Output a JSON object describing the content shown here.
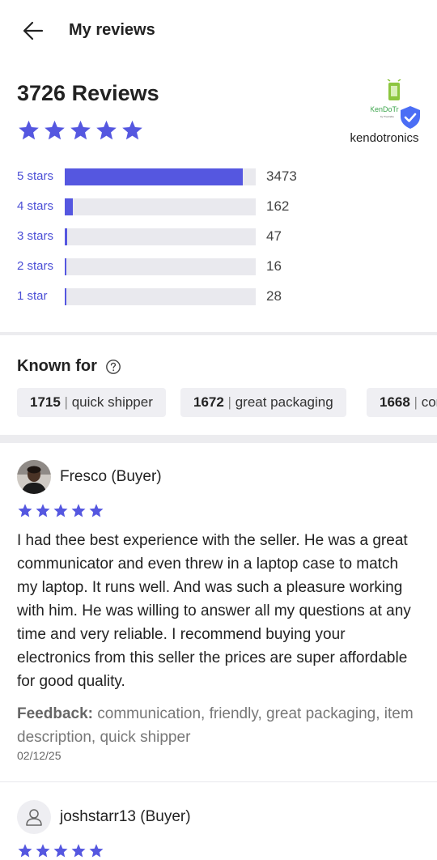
{
  "header": {
    "title": "My reviews",
    "back_icon": "arrow-left-icon"
  },
  "summary": {
    "count_label": "3726 Reviews",
    "rating": 5,
    "star_color": "#5557e0"
  },
  "seller": {
    "name": "kendotronics",
    "logo_text": "KenDoTr",
    "verified_icon": "shield-check-icon",
    "accent": "#4b6ef5"
  },
  "distribution": {
    "total": 3726,
    "rows": [
      {
        "label": "5 stars",
        "count": "3473",
        "fraction": 0.932
      },
      {
        "label": "4 stars",
        "count": "162",
        "fraction": 0.043
      },
      {
        "label": "3 stars",
        "count": "47",
        "fraction": 0.013
      },
      {
        "label": "2 stars",
        "count": "16",
        "fraction": 0.004
      },
      {
        "label": "1 star",
        "count": "28",
        "fraction": 0.008
      }
    ]
  },
  "known_for": {
    "title": "Known for",
    "help_icon": "question-circle-icon",
    "chips": [
      {
        "count": "1715",
        "label": "quick shipper"
      },
      {
        "count": "1672",
        "label": "great packaging"
      },
      {
        "count": "1668",
        "label": "communication"
      }
    ]
  },
  "reviews": [
    {
      "reviewer": "Fresco (Buyer)",
      "rating": 5,
      "text": "I had thee best experience with the seller. He was a great communicator and even threw in a laptop case to match my laptop. It runs well. And was such a pleasure working with him. He was willing to answer all my questions at any time and very reliable. I recommend buying your electronics from this seller the prices are super affordable for good quality.",
      "feedback_label": "Feedback:",
      "feedback": "communication, friendly, great packaging, item description, quick shipper",
      "date": "02/12/25"
    },
    {
      "reviewer": "joshstarr13 (Buyer)",
      "rating": 5
    }
  ]
}
